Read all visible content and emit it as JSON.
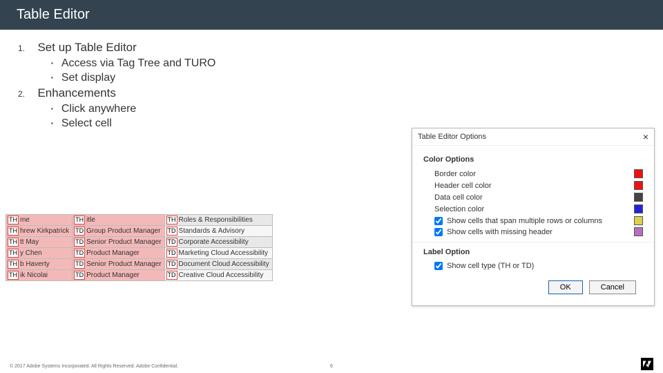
{
  "header": {
    "title": "Table Editor"
  },
  "outline": {
    "items": [
      {
        "num": "1.",
        "text": "Set up Table Editor",
        "subs": [
          "Access via Tag Tree and TURO",
          "Set display"
        ]
      },
      {
        "num": "2.",
        "text": "Enhancements",
        "subs": [
          "Click anywhere",
          "Select cell"
        ]
      }
    ]
  },
  "table_sample": {
    "rows": [
      {
        "cells": [
          {
            "tag": "TH",
            "txt": "me",
            "hdr": true
          },
          {
            "tag": "TH",
            "txt": "itle",
            "hdr": true
          },
          {
            "tag": "TH",
            "txt": "Roles & Responsibilities",
            "hdr": false,
            "shade": true
          }
        ]
      },
      {
        "cells": [
          {
            "tag": "TH",
            "txt": "hrew Kirkpatrick",
            "hdr": true
          },
          {
            "tag": "TD",
            "txt": "Group Product Manager",
            "hdr": true
          },
          {
            "tag": "TD",
            "txt": "Standards & Advisory",
            "hdr": false,
            "shade": false
          }
        ]
      },
      {
        "cells": [
          {
            "tag": "TH",
            "txt": "tt May",
            "hdr": true
          },
          {
            "tag": "TD",
            "txt": "Senior Product Manager",
            "hdr": true
          },
          {
            "tag": "TD",
            "txt": "Corporate Accessibility",
            "hdr": false,
            "shade": true
          }
        ]
      },
      {
        "cells": [
          {
            "tag": "TH",
            "txt": "y Chen",
            "hdr": true
          },
          {
            "tag": "TD",
            "txt": "Product Manager",
            "hdr": true
          },
          {
            "tag": "TD",
            "txt": "Marketing Cloud Accessibility",
            "hdr": false,
            "shade": false
          }
        ]
      },
      {
        "cells": [
          {
            "tag": "TH",
            "txt": "b Haverty",
            "hdr": true
          },
          {
            "tag": "TD",
            "txt": "Senior Product Manager",
            "hdr": true
          },
          {
            "tag": "TD",
            "txt": "Document Cloud Accessibility",
            "hdr": false,
            "shade": true
          }
        ]
      },
      {
        "cells": [
          {
            "tag": "TH",
            "txt": "ik Nicolai",
            "hdr": true
          },
          {
            "tag": "TD",
            "txt": "Product Manager",
            "hdr": true
          },
          {
            "tag": "TD",
            "txt": "Creative Cloud Accessibility",
            "hdr": false,
            "shade": false
          }
        ]
      }
    ]
  },
  "dialog": {
    "title": "Table Editor Options",
    "section1": "Color Options",
    "colors": [
      {
        "label": "Border color",
        "hex": "#e11"
      },
      {
        "label": "Header cell color",
        "hex": "#e11"
      },
      {
        "label": "Data cell color",
        "hex": "#444"
      },
      {
        "label": "Selection color",
        "hex": "#22d"
      }
    ],
    "checks": [
      {
        "label": "Show cells that span multiple rows or columns",
        "checked": true,
        "swatch": "#dcd24a"
      },
      {
        "label": "Show cells with missing header",
        "checked": true,
        "swatch": "#b56fbf"
      }
    ],
    "section2": "Label Option",
    "check2": {
      "label": "Show cell type (TH or TD)",
      "checked": true
    },
    "buttons": {
      "ok": "OK",
      "cancel": "Cancel"
    }
  },
  "footer": {
    "copyright": "© 2017 Adobe Systems Incorporated.  All Rights Reserved.  Adobe Confidential.",
    "page": "6"
  }
}
